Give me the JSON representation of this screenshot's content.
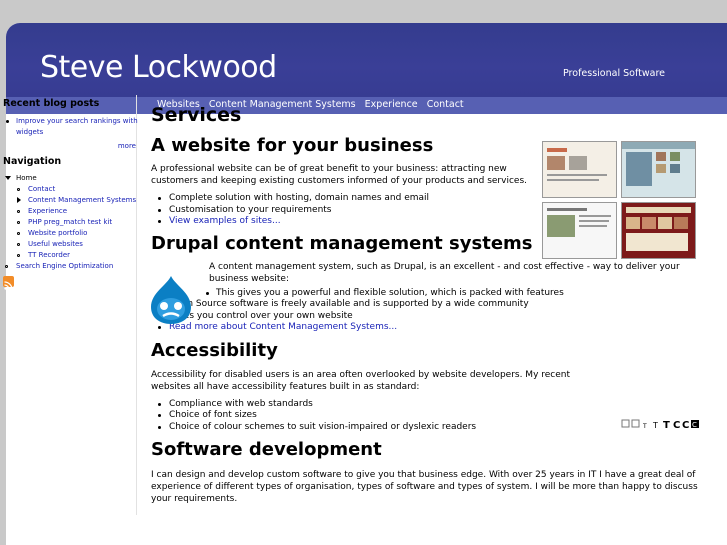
{
  "header": {
    "site_name": "Steve Lockwood",
    "slogan": "Professional Software"
  },
  "primary_nav": [
    "Websites",
    "Content Management Systems",
    "Experience",
    "Contact"
  ],
  "sidebar": {
    "blog": {
      "heading": "Recent blog posts",
      "items": [
        "Improve your search rankings with widgets"
      ],
      "more": "more"
    },
    "navigation": {
      "heading": "Navigation",
      "home": "Home",
      "children": [
        "Contact",
        "Content Management Systems",
        "Experience",
        "PHP preg_match test kit",
        "Website portfolio",
        "Useful websites",
        "TT Recorder"
      ],
      "seo": "Search Engine Optimization"
    }
  },
  "main": {
    "title": "Services",
    "website": {
      "heading": "A website for your business",
      "intro": "A professional website can be of great benefit to your business: attracting new customers and keeping existing customers informed of your products and services.",
      "items": [
        "Complete solution with hosting, domain names and email",
        "Customisation to your requirements"
      ],
      "link": "View examples of sites..."
    },
    "drupal": {
      "heading": "Drupal content management systems",
      "intro": "A content management system, such as Drupal, is an excellent - and cost effective - way to deliver your business website:",
      "items": [
        "This gives you a powerful and flexible solution, which is packed with features",
        "Open Source software is freely available and is supported by a wide community",
        "Gives you control over your own website"
      ],
      "link": "Read more about Content Management Systems..."
    },
    "accessibility": {
      "heading": "Accessibility",
      "intro": "Accessibility for disabled users is an area often overlooked by website developers.  My recent websites all have accessibility features built in as standard:",
      "items": [
        "Compliance with web standards",
        "Choice of font sizes",
        "Choice of colour schemes to suit vision-impaired or dyslexic readers"
      ],
      "icons": "T T T C C C"
    },
    "software": {
      "heading": "Software development",
      "intro": "I can design and develop custom software to give you that business edge.  With over 25 years in IT I have a great deal of experience of different types of organisation, types of software and types of system.  I will be more than happy to discuss your requirements."
    }
  },
  "colors": {
    "header": "#3a3f97",
    "navbar": "#5760b3",
    "link": "#1a23b7"
  }
}
